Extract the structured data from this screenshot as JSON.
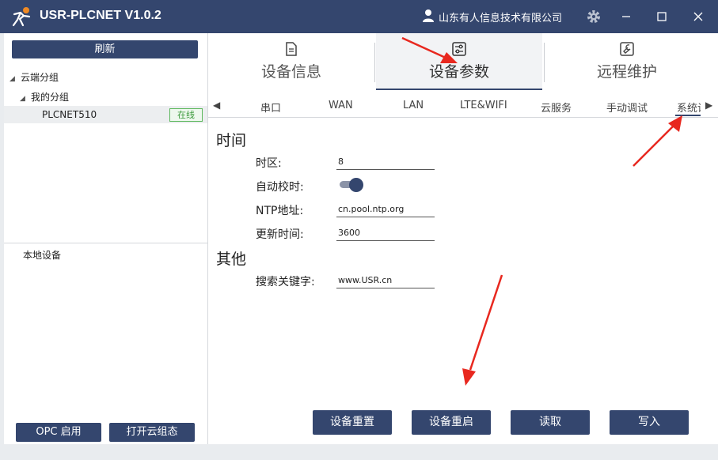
{
  "window": {
    "title": "USR-PLCNET V1.0.2",
    "user": "山东有人信息技术有限公司"
  },
  "sidebar": {
    "refresh_label": "刷新",
    "tree": {
      "cloud_group": "云端分组",
      "my_group": "我的分组",
      "device": "PLCNET510",
      "device_status": "在线"
    },
    "local_devices": "本地设备",
    "opc_label": "OPC 启用",
    "cloud_config_label": "打开云组态"
  },
  "main_tabs": [
    {
      "label": "设备信息",
      "icon": "document-icon"
    },
    {
      "label": "设备参数",
      "icon": "sliders-icon",
      "active": true
    },
    {
      "label": "远程维护",
      "icon": "wrench-icon"
    }
  ],
  "sub_tabs": [
    "串口",
    "WAN",
    "LAN",
    "LTE&WIFI",
    "云服务",
    "手动调试",
    "系统设"
  ],
  "sections": {
    "time_title": "时间",
    "other_title": "其他"
  },
  "fields": {
    "timezone_label": "时区:",
    "timezone_value": "8",
    "auto_sync_label": "自动校时:",
    "auto_sync_on": true,
    "ntp_label": "NTP地址:",
    "ntp_value": "cn.pool.ntp.org",
    "update_label": "更新时间:",
    "update_value": "3600",
    "keyword_label": "搜索关键字:",
    "keyword_value": "www.USR.cn"
  },
  "actions": {
    "reset": "设备重置",
    "restart": "设备重启",
    "read": "读取",
    "write": "写入"
  },
  "colors": {
    "primary": "#34466e",
    "online": "#3c9a3c",
    "annotation": "#e8281f"
  }
}
